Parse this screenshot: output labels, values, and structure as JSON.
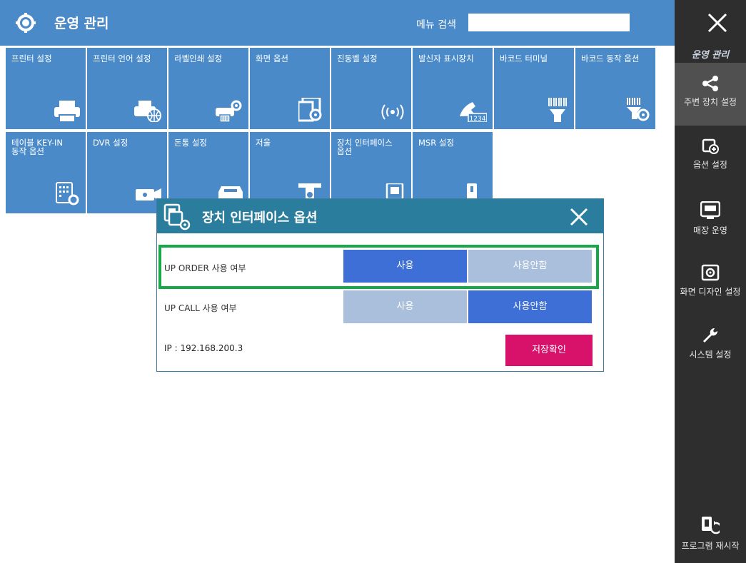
{
  "header": {
    "title": "운영 관리",
    "search_label": "메뉴 검색",
    "search_value": ""
  },
  "sidebar": {
    "title": "운영 관리",
    "items": [
      {
        "label": "주변 장치 설정",
        "icon": "share-icon",
        "active": true
      },
      {
        "label": "옵션 설정",
        "icon": "screen-add-icon",
        "active": false
      },
      {
        "label": "매장 운영",
        "icon": "pos-register-icon",
        "active": false
      },
      {
        "label": "화면 디자인 설정",
        "icon": "monitor-gear-icon",
        "active": false
      },
      {
        "label": "시스템 설정",
        "icon": "wrench-icon",
        "active": false
      }
    ],
    "restart_label": "프로그램 재시작"
  },
  "tiles": [
    {
      "label": "프린터 설정",
      "icon": "printer-icon"
    },
    {
      "label": "프린터 언어 설정",
      "icon": "printer-globe-icon"
    },
    {
      "label": "라벨인쇄 설정",
      "icon": "label-printer-icon"
    },
    {
      "label": "화면 옵션",
      "icon": "screen-gear-icon"
    },
    {
      "label": "진동벨 설정",
      "icon": "vibration-bell-icon"
    },
    {
      "label": "발신자 표시장치",
      "icon": "caller-id-icon"
    },
    {
      "label": "바코드 터미널",
      "icon": "barcode-scanner-icon"
    },
    {
      "label": "바코드 동작 옵션",
      "icon": "barcode-gear-icon"
    },
    {
      "label": "테이블 KEY-IN 동작 옵션",
      "icon": "keypad-gear-icon"
    },
    {
      "label": "DVR 설정",
      "icon": "camera-icon"
    },
    {
      "label": "돈통 설정",
      "icon": "cash-drawer-icon"
    },
    {
      "label": "저울",
      "icon": "scale-icon"
    },
    {
      "label": "장치 인터페이스 옵션",
      "icon": "device-interface-icon"
    },
    {
      "label": "MSR 설정",
      "icon": "card-reader-icon"
    }
  ],
  "dialog": {
    "title": "장치 인터페이스 옵션",
    "rows": [
      {
        "label": "UP ORDER 사용 여부",
        "use": "사용",
        "not_use": "사용안함",
        "selected": "use"
      },
      {
        "label": "UP CALL 사용 여부",
        "use": "사용",
        "not_use": "사용안함",
        "selected": "not_use"
      }
    ],
    "ip_label": "IP : 192.168.200.3",
    "save_label": "저장확인"
  },
  "colors": {
    "tile": "#4a8ac9",
    "dialog_header": "#2a7d9c",
    "selected": "#3e6fd7",
    "unselected": "#a9bfdb",
    "save": "#d8116b",
    "highlight": "#18a84a",
    "sidebar": "#2e2e2e"
  }
}
